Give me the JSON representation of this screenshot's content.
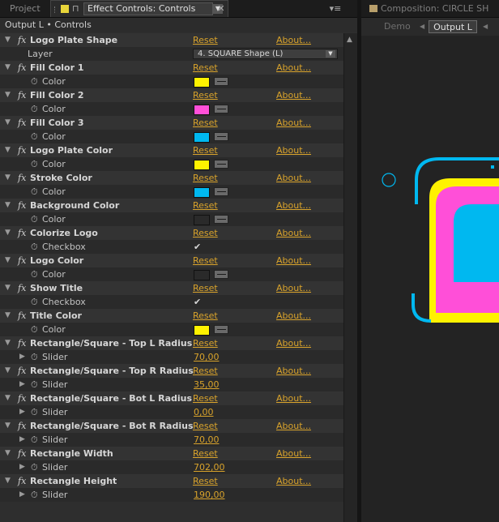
{
  "tabs": {
    "project": "Project",
    "effect_controls": "Effect Controls: Controls",
    "composition": "Composition: CIRCLE SH"
  },
  "breadcrumb": "Output L • Controls",
  "links": {
    "reset": "Reset",
    "about": "About..."
  },
  "layer_row": {
    "label": "Layer",
    "value": "4. SQUARE Shape (L)"
  },
  "effects": [
    {
      "name": "Logo Plate Shape",
      "kind": "layer"
    },
    {
      "name": "Fill Color 1",
      "kind": "color",
      "param": "Color",
      "color": "#fff200"
    },
    {
      "name": "Fill Color 2",
      "kind": "color",
      "param": "Color",
      "color": "#ff4fd8"
    },
    {
      "name": "Fill Color 3",
      "kind": "color",
      "param": "Color",
      "color": "#00b8f0"
    },
    {
      "name": "Logo Plate Color",
      "kind": "color",
      "param": "Color",
      "color": "#fff200"
    },
    {
      "name": "Stroke Color",
      "kind": "color",
      "param": "Color",
      "color": "#00b8f0"
    },
    {
      "name": "Background Color",
      "kind": "color",
      "param": "Color",
      "color": "#2a2a2a"
    },
    {
      "name": "Colorize Logo",
      "kind": "checkbox",
      "param": "Checkbox",
      "value": "✔"
    },
    {
      "name": "Logo Color",
      "kind": "color",
      "param": "Color",
      "color": "#2a2a2a"
    },
    {
      "name": "Show Title",
      "kind": "checkbox",
      "param": "Checkbox",
      "value": "✔"
    },
    {
      "name": "Title Color",
      "kind": "color",
      "param": "Color",
      "color": "#fff200"
    },
    {
      "name": "Rectangle/Square - Top L Radius",
      "kind": "slider",
      "param": "Slider",
      "value": "70,00"
    },
    {
      "name": "Rectangle/Square - Top R Radius",
      "kind": "slider",
      "param": "Slider",
      "value": "35,00"
    },
    {
      "name": "Rectangle/Square - Bot L Radius",
      "kind": "slider",
      "param": "Slider",
      "value": "0,00"
    },
    {
      "name": "Rectangle/Square - Bot R Radius",
      "kind": "slider",
      "param": "Slider",
      "value": "70,00"
    },
    {
      "name": "Rectangle Width",
      "kind": "slider",
      "param": "Slider",
      "value": "702,00"
    },
    {
      "name": "Rectangle Height",
      "kind": "slider",
      "param": "Slider",
      "value": "190,00"
    }
  ],
  "comp_tabs": {
    "demo": "Demo",
    "output": "Output L"
  },
  "colors": {
    "accent_link": "#d9a32b",
    "cyan": "#00b8f0",
    "yellow": "#fff200",
    "magenta": "#ff4fd8"
  }
}
